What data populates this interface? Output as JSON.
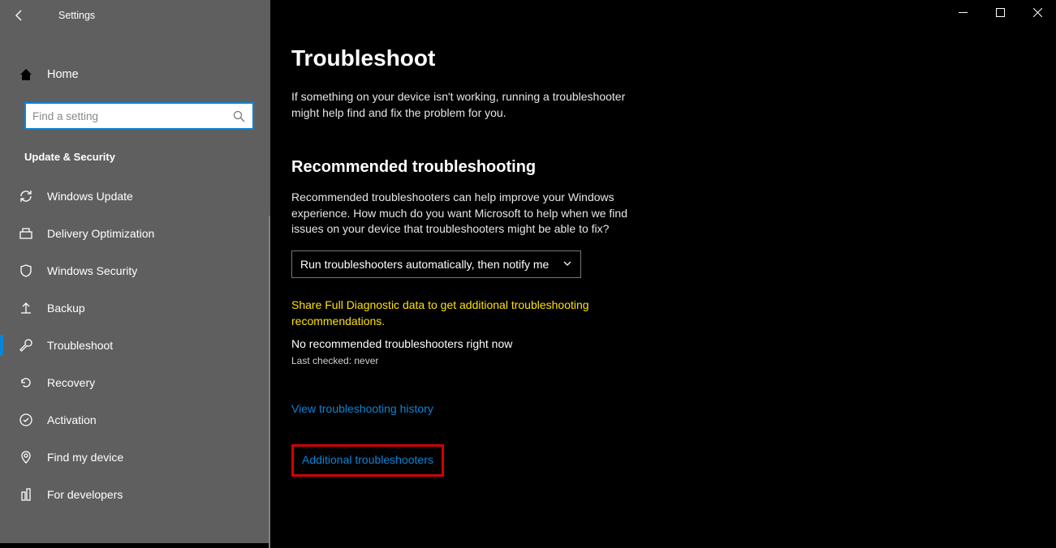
{
  "window": {
    "app_title": "Settings"
  },
  "sidebar": {
    "home_label": "Home",
    "search_placeholder": "Find a setting",
    "section_title": "Update & Security",
    "items": [
      {
        "label": "Windows Update"
      },
      {
        "label": "Delivery Optimization"
      },
      {
        "label": "Windows Security"
      },
      {
        "label": "Backup"
      },
      {
        "label": "Troubleshoot"
      },
      {
        "label": "Recovery"
      },
      {
        "label": "Activation"
      },
      {
        "label": "Find my device"
      },
      {
        "label": "For developers"
      }
    ]
  },
  "main": {
    "title": "Troubleshoot",
    "intro": "If something on your device isn't working, running a troubleshooter might help find and fix the problem for you.",
    "section_heading": "Recommended troubleshooting",
    "section_text": "Recommended troubleshooters can help improve your Windows experience. How much do you want Microsoft to help when we find issues on your device that troubleshooters might be able to fix?",
    "dropdown_value": "Run troubleshooters automatically, then notify me",
    "warning_text": "Share Full Diagnostic data to get additional troubleshooting recommendations.",
    "status_text": "No recommended troubleshooters right now",
    "last_checked": "Last checked: never",
    "history_link": "View troubleshooting history",
    "additional_link": "Additional troubleshooters"
  }
}
